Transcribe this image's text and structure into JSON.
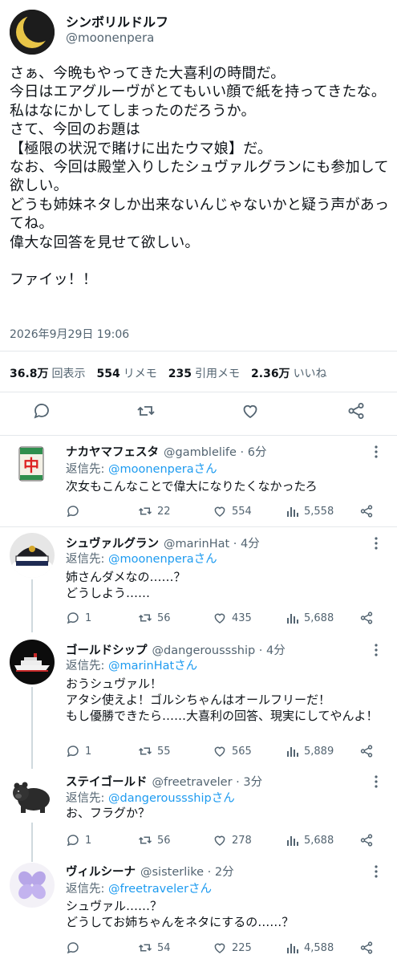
{
  "main_tweet": {
    "display_name": "シンボリルドルフ",
    "handle": "@moonenpera",
    "text": "さぁ、今晩もやってきた大喜利の時間だ。\n今日はエアグルーヴがとてもいい顔で紙を持ってきたな。\n私はなにかしてしまったのだろうか。\nさて、今回のお題は\n【極限の状況で賭けに出たウマ娘】だ。\nなお、今回は殿堂入りしたシュヴァルグランにも参加して欲しい。\nどうも姉妹ネタしか出来ないんじゃないかと疑う声があってね。\n偉大な回答を見せて欲しい。\n\nファイッ！！",
    "timestamp": "2026年9月29日 19:06",
    "stats": {
      "views_count": "36.8万",
      "views_label": "回表示",
      "retweets_count": "554",
      "retweets_label": "リメモ",
      "quotes_count": "235",
      "quotes_label": "引用メモ",
      "likes_count": "2.36万",
      "likes_label": "いいね"
    }
  },
  "replies": [
    {
      "display_name": "ナカヤマフェスタ",
      "handle": "@gamblelife · 6分",
      "reply_prefix": "返信先: ",
      "reply_to": "@moonenperaさん",
      "text": "次女もこんなことで偉大になりたくなかったろ",
      "comments": "",
      "retweets": "22",
      "likes": "554",
      "views": "5,558",
      "avatar": "mahjong-tile-icon"
    },
    {
      "display_name": "シュヴァルグラン",
      "handle": "@marinHat · 4分",
      "reply_prefix": "返信先: ",
      "reply_to": "@moonenperaさん",
      "text": "姉さんダメなの……？\nどうしよう……",
      "comments": "1",
      "retweets": "56",
      "likes": "435",
      "views": "5,688",
      "avatar": "captain-hat-icon"
    },
    {
      "display_name": "ゴールドシップ",
      "handle": "@dangeroussship · 4分",
      "reply_prefix": "返信先: ",
      "reply_to": "@marinHatさん",
      "text": "おうシュヴァル！\nアタシ使えよ！ゴルシちゃんはオールフリーだ！\nもし優勝できたら……大喜利の回答、現実にしてやんよ！",
      "comments": "1",
      "retweets": "55",
      "likes": "565",
      "views": "5,889",
      "avatar": "cruise-ship-icon"
    },
    {
      "display_name": "ステイゴールド",
      "handle": "@freetraveler · 3分",
      "reply_prefix": "返信先: ",
      "reply_to": "@dangeroussshipさん",
      "text": "お、フラグか？",
      "comments": "1",
      "retweets": "56",
      "likes": "278",
      "views": "5,688",
      "avatar": "bear-icon"
    },
    {
      "display_name": "ヴィルシーナ",
      "handle": "@sisterlike · 2分",
      "reply_prefix": "返信先: ",
      "reply_to": "@freetravelerさん",
      "text": "シュヴァル……？\nどうしてお姉ちゃんをネタにするの……？",
      "comments": "",
      "retweets": "54",
      "likes": "225",
      "views": "4,588",
      "avatar": "violet-flower-icon"
    }
  ],
  "colors": {
    "text": "#0f1419",
    "secondary": "#536471",
    "link": "#1d9bf0",
    "divider": "#e4e8eb",
    "thread_line": "#cfd9de"
  }
}
